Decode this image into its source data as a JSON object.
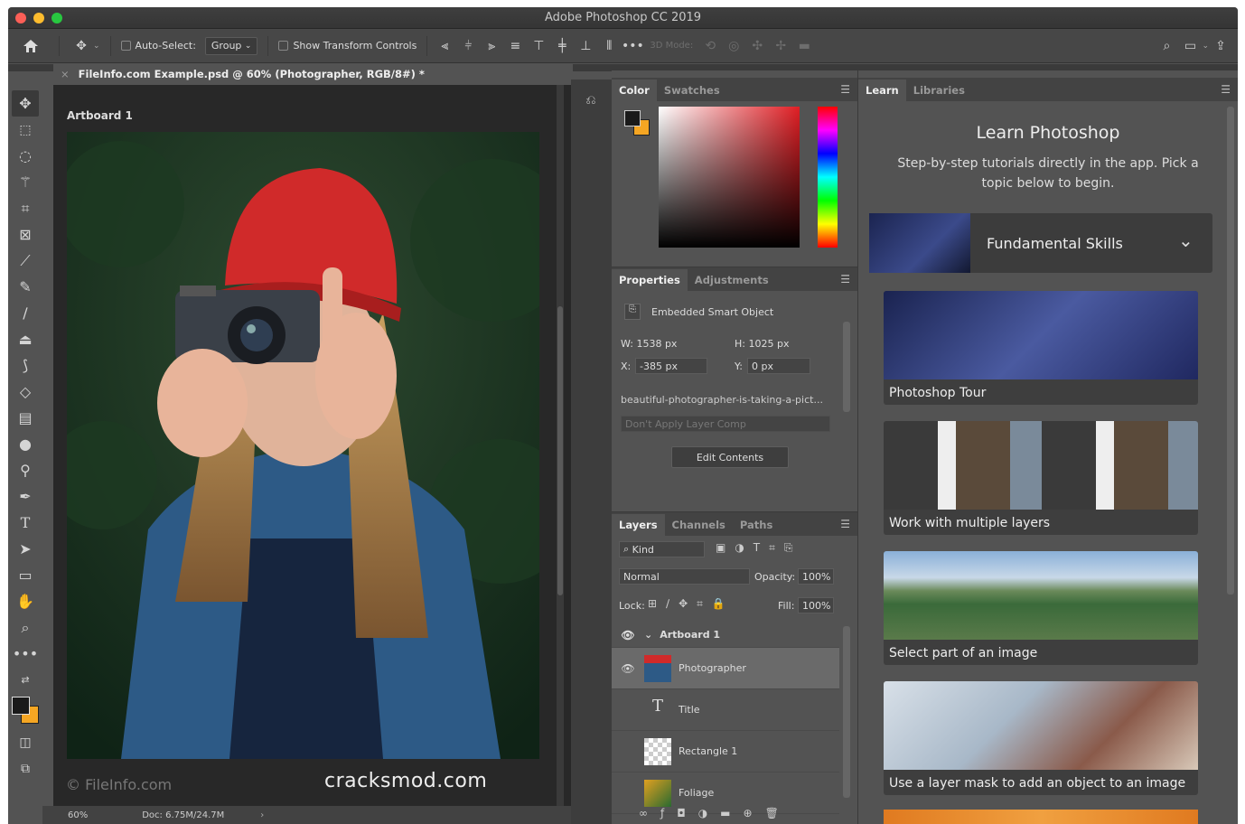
{
  "window": {
    "title": "Adobe Photoshop CC 2019"
  },
  "options": {
    "auto_select": "Auto-Select:",
    "group": "Group",
    "show_transform": "Show Transform Controls",
    "three_d_mode": "3D Mode:"
  },
  "document": {
    "tab": "FileInfo.com Example.psd @ 60% (Photographer, RGB/8#) *",
    "artboard": "Artboard 1",
    "watermark_left": "© FileInfo.com",
    "watermark_right": "cracksmod.com",
    "zoom": "60%",
    "doc_size": "Doc: 6.75M/24.7M"
  },
  "color_panel": {
    "tabs": [
      "Color",
      "Swatches"
    ]
  },
  "properties": {
    "tabs": [
      "Properties",
      "Adjustments"
    ],
    "kind": "Embedded Smart Object",
    "w_label": "W:",
    "w": "1538 px",
    "h_label": "H:",
    "h": "1025 px",
    "x_label": "X:",
    "x": "-385 px",
    "y_label": "Y:",
    "y": "0 px",
    "filename": "beautiful-photographer-is-taking-a-pict...",
    "layer_comp": "Don't Apply Layer Comp",
    "edit_button": "Edit Contents"
  },
  "layers": {
    "tabs": [
      "Layers",
      "Channels",
      "Paths"
    ],
    "filter": "Kind",
    "blend": "Normal",
    "opacity_label": "Opacity:",
    "opacity": "100%",
    "lock_label": "Lock:",
    "fill_label": "Fill:",
    "fill": "100%",
    "artboard": "Artboard 1",
    "items": [
      "Photographer",
      "Title",
      "Rectangle 1",
      "Foliage"
    ]
  },
  "learn": {
    "tabs": [
      "Learn",
      "Libraries"
    ],
    "heading": "Learn Photoshop",
    "sub": "Step-by-step tutorials directly in the app. Pick a topic below to begin.",
    "section": "Fundamental Skills",
    "cards": [
      "Photoshop Tour",
      "Work with multiple layers",
      "Select part of an image",
      "Use a layer mask to add an object to an image"
    ]
  },
  "icons": [
    "home-icon",
    "move-icon",
    "align-left-icon",
    "search-icon",
    "workspace-icon",
    "share-icon",
    "eye-icon",
    "menu-icon"
  ],
  "colors": {
    "foreground": "#1a1a1a",
    "background": "#f5a623",
    "accent": "#3a6ea5"
  }
}
